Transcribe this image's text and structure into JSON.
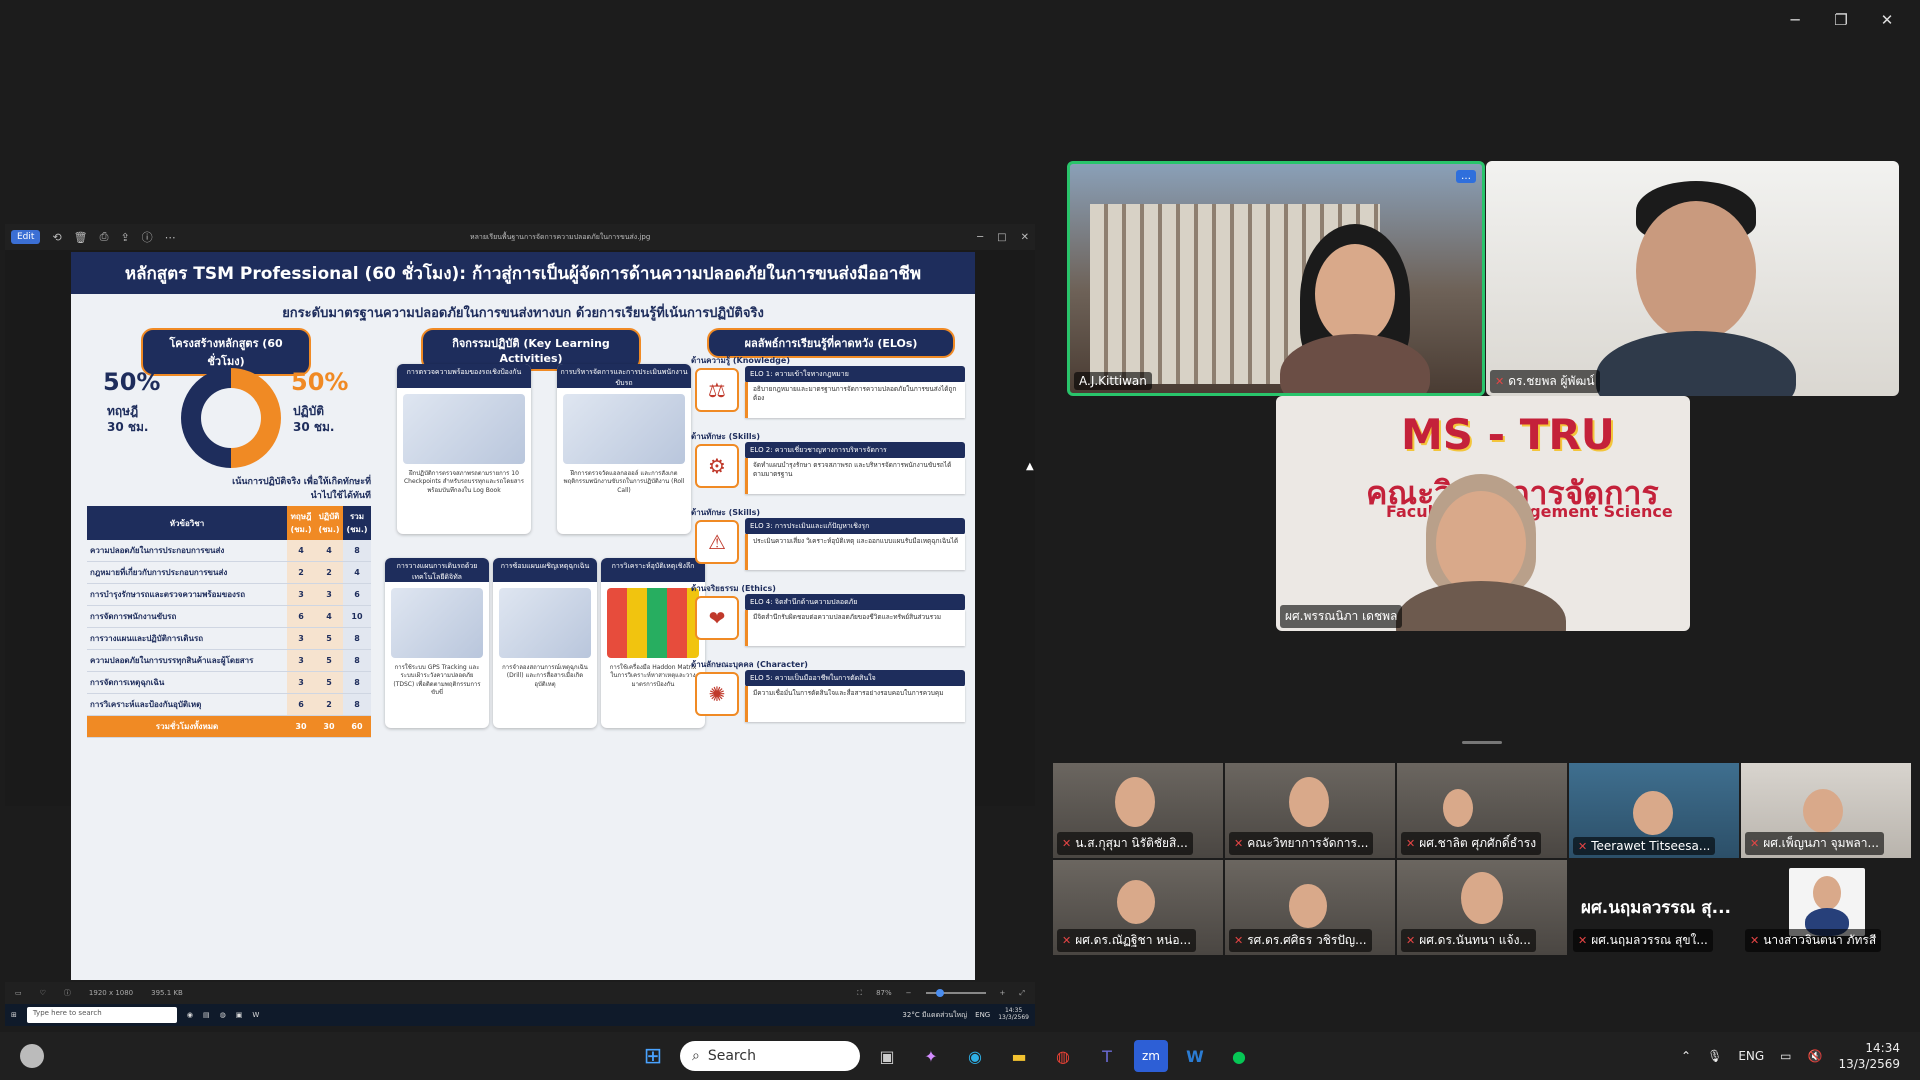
{
  "window": {
    "minimize": "─",
    "restore": "❐",
    "close": "✕"
  },
  "viewer": {
    "edit": "Edit",
    "filename": "หลายเรียนพื้นฐานการจัดการความปลอดภัยในการขนส่ง.jpg",
    "footer_dims": "1920 x 1080",
    "footer_size": "395.1 KB",
    "zoom": "87%"
  },
  "poster": {
    "title": "หลักสูตร TSM Professional (60 ชั่วโมง): ก้าวสู่การเป็นผู้จัดการด้านความปลอดภัยในการขนส่งมืออาชีพ",
    "subtitle": "ยกระดับมาตรฐานความปลอดภัยในการขนส่งทางบก ด้วยการเรียนรู้ที่เน้นการปฏิบัติจริง",
    "col1_head": "โครงสร้างหลักสูตร (60 ชั่วโมง)",
    "theory_pct": "50%",
    "theory_label": "ทฤษฎี",
    "theory_hours": "30 ชม.",
    "practice_pct": "50%",
    "practice_label": "ปฏิบัติ",
    "practice_hours": "30 ชม.",
    "focus": "เน้นการปฏิบัติจริง เพื่อให้เกิดทักษะที่นำไปใช้ได้ทันที",
    "table_head": [
      "หัวข้อวิชา",
      "ทฤษฎี (ชม.)",
      "ปฏิบัติ (ชม.)",
      "รวม (ชม.)"
    ],
    "rows": [
      {
        "subject": "ความปลอดภัยในการประกอบการขนส่ง",
        "t": "4",
        "p": "4",
        "s": "8"
      },
      {
        "subject": "กฎหมายที่เกี่ยวกับการประกอบการขนส่ง",
        "t": "2",
        "p": "2",
        "s": "4"
      },
      {
        "subject": "การบำรุงรักษารถและตรวจความพร้อมของรถ",
        "t": "3",
        "p": "3",
        "s": "6"
      },
      {
        "subject": "การจัดการพนักงานขับรถ",
        "t": "6",
        "p": "4",
        "s": "10"
      },
      {
        "subject": "การวางแผนและปฏิบัติการเดินรถ",
        "t": "3",
        "p": "5",
        "s": "8"
      },
      {
        "subject": "ความปลอดภัยในการบรรทุกสินค้าและผู้โดยสาร",
        "t": "3",
        "p": "5",
        "s": "8"
      },
      {
        "subject": "การจัดการเหตุฉุกเฉิน",
        "t": "3",
        "p": "5",
        "s": "8"
      },
      {
        "subject": "การวิเคราะห์และป้องกันอุบัติเหตุ",
        "t": "6",
        "p": "2",
        "s": "8"
      }
    ],
    "total": {
      "label": "รวมชั่วโมงทั้งหมด",
      "t": "30",
      "p": "30",
      "s": "60"
    },
    "col2_head": "กิจกรรมปฏิบัติ (Key Learning Activities)",
    "cards": [
      {
        "head": "การตรวจความพร้อมของรถเชิงป้องกัน",
        "body": "ฝึกปฏิบัติการตรวจสภาพรถตามรายการ 10 Checkpoints สำหรับรถบรรทุกและรถโดยสาร พร้อมบันทึกลงใน Log Book"
      },
      {
        "head": "การบริหารจัดการและการประเมินพนักงานขับรถ",
        "body": "ฝึกการตรวจวัดแอลกอฮอล์ และการสังเกตพฤติกรรมพนักงานขับรถในการปฏิบัติงาน (Roll Call)"
      },
      {
        "head": "การวางแผนการเดินรถด้วยเทคโนโลยีดิจิทัล",
        "body": "การใช้ระบบ GPS Tracking และระบบเฝ้าระวังความปลอดภัย (TDSC) เพื่อติดตามพฤติกรรมการขับขี่"
      },
      {
        "head": "การซ้อมแผนเผชิญเหตุฉุกเฉิน",
        "body": "การจำลองสถานการณ์เหตุฉุกเฉิน (Drill) และการสื่อสารเมื่อเกิดอุบัติเหตุ"
      },
      {
        "head": "การวิเคราะห์อุบัติเหตุเชิงลึก",
        "body": "การใช้เครื่องมือ Haddon Matrix ในการวิเคราะห์หาสาเหตุและวางมาตรการป้องกัน"
      }
    ],
    "col3_head": "ผลลัพธ์การเรียนรู้ที่คาดหวัง (ELOs)",
    "elos": [
      {
        "section": "ด้านความรู้ (Knowledge)",
        "title": "ELO 1: ความเข้าใจทางกฎหมาย",
        "body": "อธิบายกฎหมายและมาตรฐานการจัดการความปลอดภัยในการขนส่งได้ถูกต้อง"
      },
      {
        "section": "ด้านทักษะ (Skills)",
        "title": "ELO 2: ความเชี่ยวชาญทางการบริหารจัดการ",
        "body": "จัดทำแผนบำรุงรักษา ตรวจสภาพรถ และบริหารจัดการพนักงานขับรถได้ตามมาตรฐาน"
      },
      {
        "section": "ด้านทักษะ (Skills)",
        "title": "ELO 3: การประเมินและแก้ปัญหาเชิงรุก",
        "body": "ประเมินความเสี่ยง วิเคราะห์อุบัติเหตุ และออกแบบแผนรับมือเหตุฉุกเฉินได้"
      },
      {
        "section": "ด้านจริยธรรม (Ethics)",
        "title": "ELO 4: จิตสำนึกด้านความปลอดภัย",
        "body": "มีจิตสำนึกรับผิดชอบต่อความปลอดภัยของชีวิตและทรัพย์สินส่วนรวม"
      },
      {
        "section": "ด้านลักษณะบุคคล (Character)",
        "title": "ELO 5: ความเป็นมืออาชีพในการตัดสินใจ",
        "body": "มีความเชื่อมั่นในการตัดสินใจและสื่อสารอย่างรอบคอบในการควบคุม"
      }
    ]
  },
  "remote_taskbar": {
    "search": "Type here to search",
    "weather": "32°C มีแดดส่วนใหญ่",
    "lang": "ENG",
    "time": "14:35",
    "date": "13/3/2569"
  },
  "participants_main": [
    {
      "name": "A.J.Kittiwan"
    },
    {
      "name": "ดร.ชยพล ผู้พัฒน์"
    },
    {
      "name": "ผศ.พรรณนิภา เดชพล"
    }
  ],
  "tile_more": "…",
  "logo": {
    "line1": "MS - TRU",
    "line2": "คณะวิทยาการจัดการ",
    "line3": "Faculty of Management Science"
  },
  "gallery": [
    {
      "name": "น.ส.กุสุมา นิรัติชัยสิ..."
    },
    {
      "name": "คณะวิทยาการจัดการ..."
    },
    {
      "name": "ผศ.ชาลิต ศุภศักดิ์ธำรง"
    },
    {
      "name": "Teerawet Titseesa..."
    },
    {
      "name": "ผศ.เพ็ญนภา จุมพลา..."
    },
    {
      "name": "ผศ.ดร.ณัฏฐิชา หน่อ..."
    },
    {
      "name": "รศ.ดร.ศศิธร วชิรปัญ..."
    },
    {
      "name": "ผศ.ดร.นันทนา แจ้ง..."
    },
    {
      "name": "ผศ.นฤมลวรรณ สุขใ..."
    },
    {
      "name": "นางสาวจินตนา ภัทรสี"
    }
  ],
  "gallery_big_text": "ผศ.นฤมลวรรณ สุ...",
  "taskbar": {
    "search": "Search",
    "lang": "ENG",
    "time": "14:34",
    "date": "13/3/2569"
  }
}
